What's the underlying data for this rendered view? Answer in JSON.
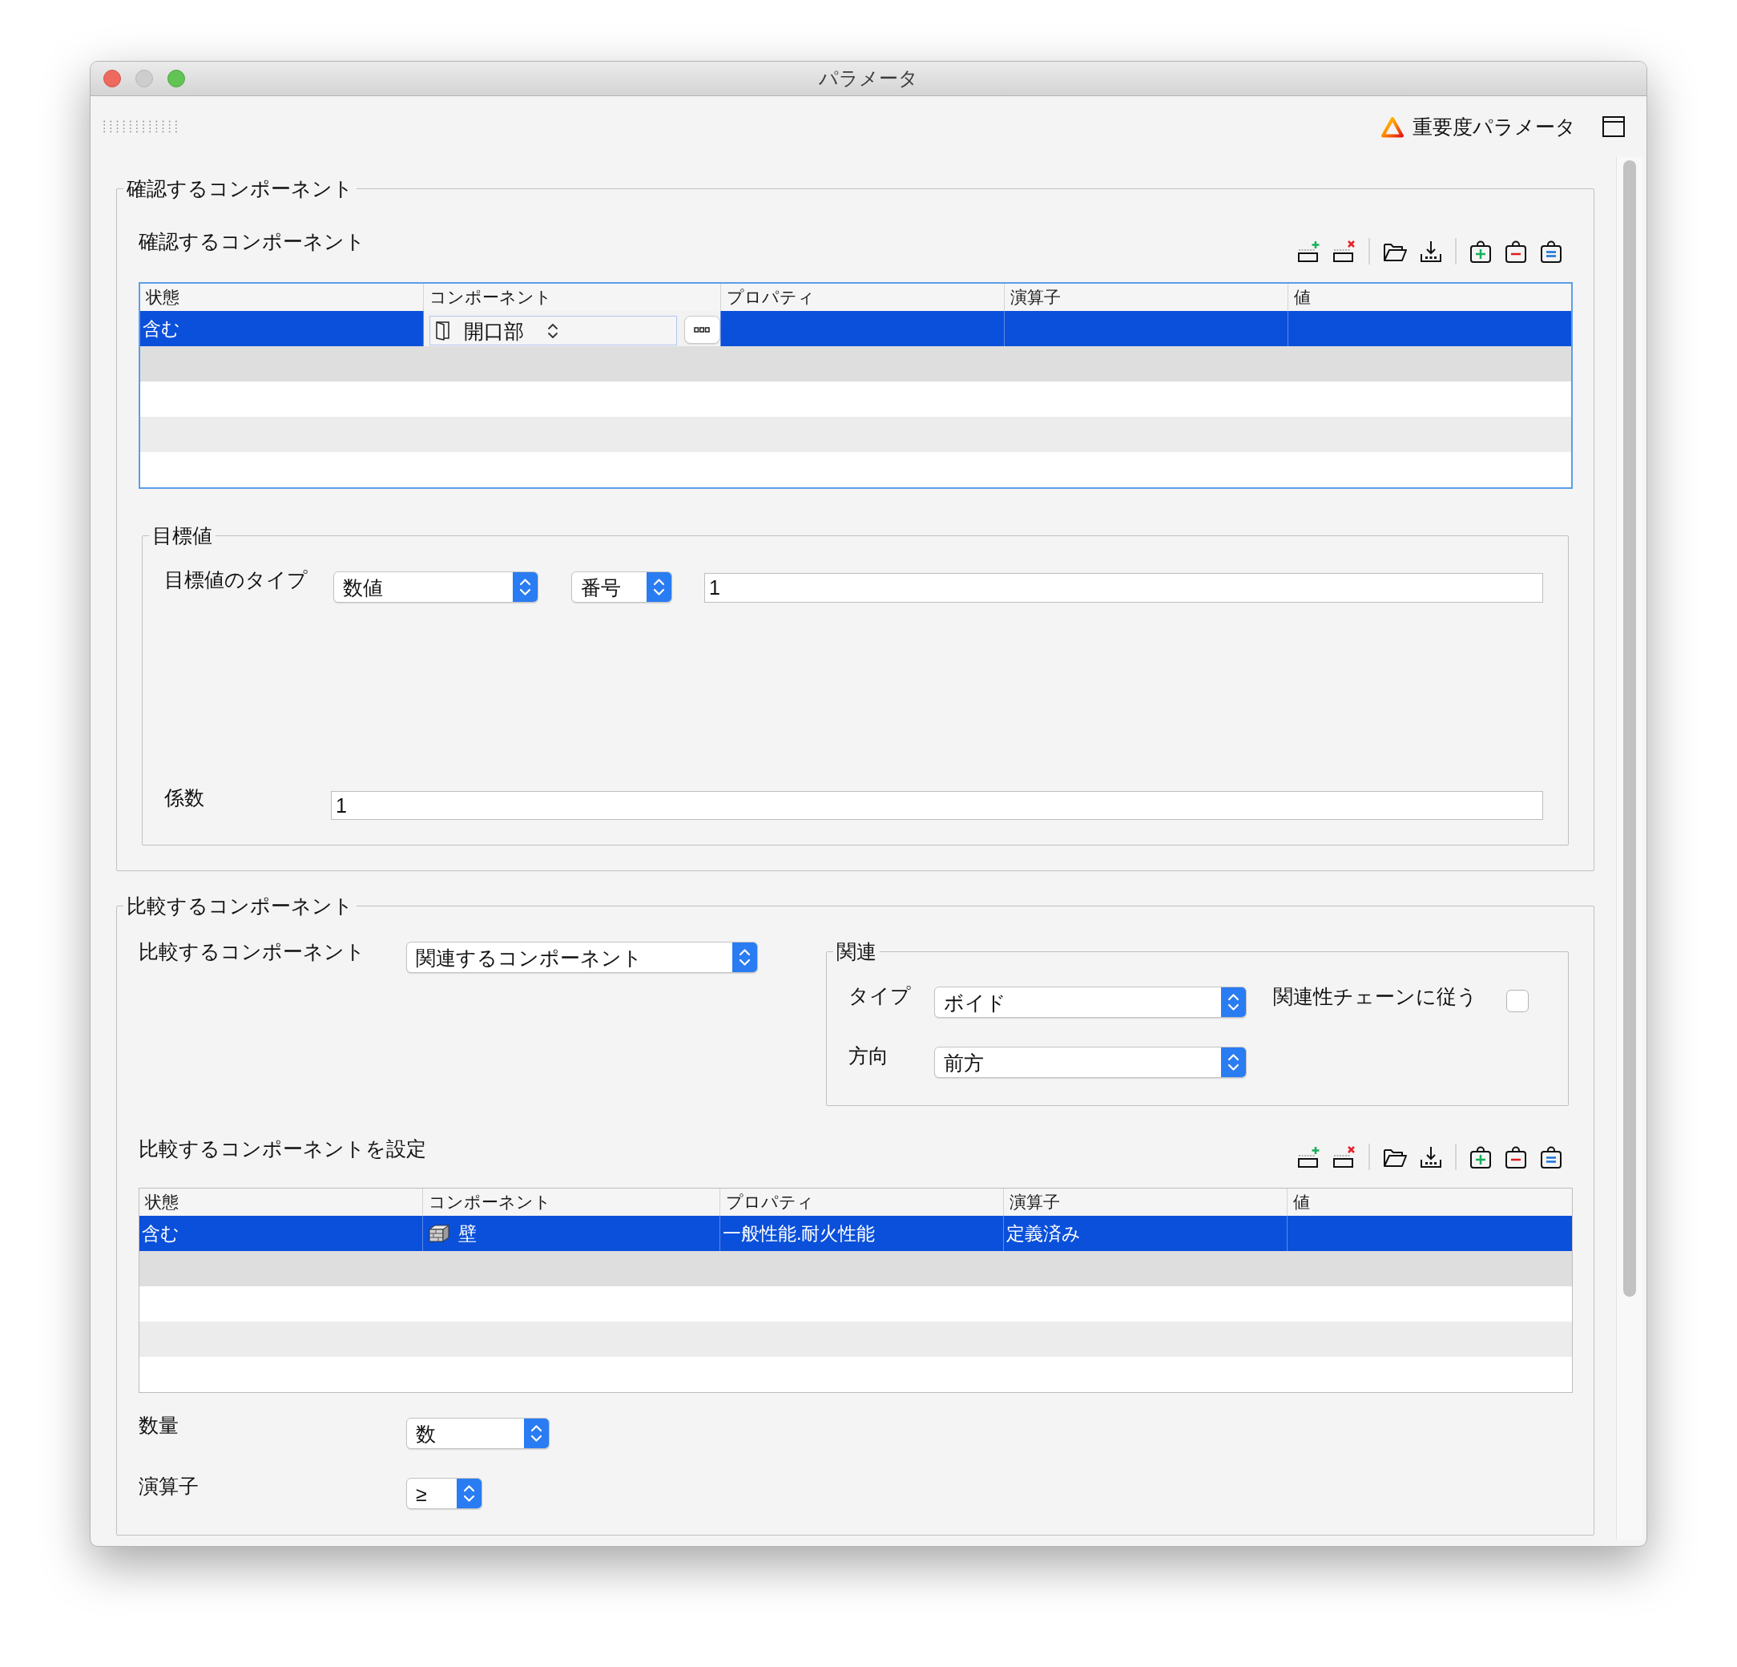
{
  "window": {
    "title": "パラメータ",
    "minimize_disabled": true
  },
  "toolbar": {
    "button": "重要度パラメータ"
  },
  "check_group": {
    "title": "確認するコンポーネント",
    "table_label": "確認するコンポーネント",
    "table": {
      "focused": true,
      "columns": [
        "状態",
        "コンポーネント",
        "プロパティ",
        "演算子",
        "値"
      ],
      "rows": [
        {
          "selected": true,
          "cells": [
            {
              "kind": "text",
              "text": "含む"
            },
            {
              "kind": "editor",
              "text": "開口部"
            }
          ]
        }
      ]
    },
    "target": {
      "title": "目標値",
      "type_label": "目標値のタイプ",
      "type_value": "数値",
      "unit_value": "番号",
      "value": "1",
      "factor_label": "係数",
      "factor_value": "1"
    }
  },
  "compare_group": {
    "title": "比較するコンポーネント",
    "source_label": "比較するコンポーネント",
    "source_value": "関連するコンポーネント",
    "relation": {
      "title": "関連",
      "type_label": "タイプ",
      "type_value": "ボイド",
      "follow_chain": {
        "label": "関連性チェーンに従う",
        "checked": false
      },
      "direction_label": "方向",
      "direction_value": "前方"
    },
    "table_label": "比較するコンポーネントを設定",
    "table": {
      "focused": false,
      "columns": [
        "状態",
        "コンポーネント",
        "プロパティ",
        "演算子",
        "値"
      ],
      "rows": [
        {
          "selected": true,
          "cells": [
            {
              "kind": "text",
              "text": "含む"
            },
            {
              "kind": "object",
              "text": "壁"
            },
            {
              "kind": "text",
              "text": "一般性能.耐火性能"
            },
            {
              "kind": "text",
              "text": "定義済み"
            }
          ]
        }
      ]
    },
    "quantity_label": "数量",
    "quantity_value": "数",
    "operator_label": "演算子",
    "operator_value": "≥"
  }
}
